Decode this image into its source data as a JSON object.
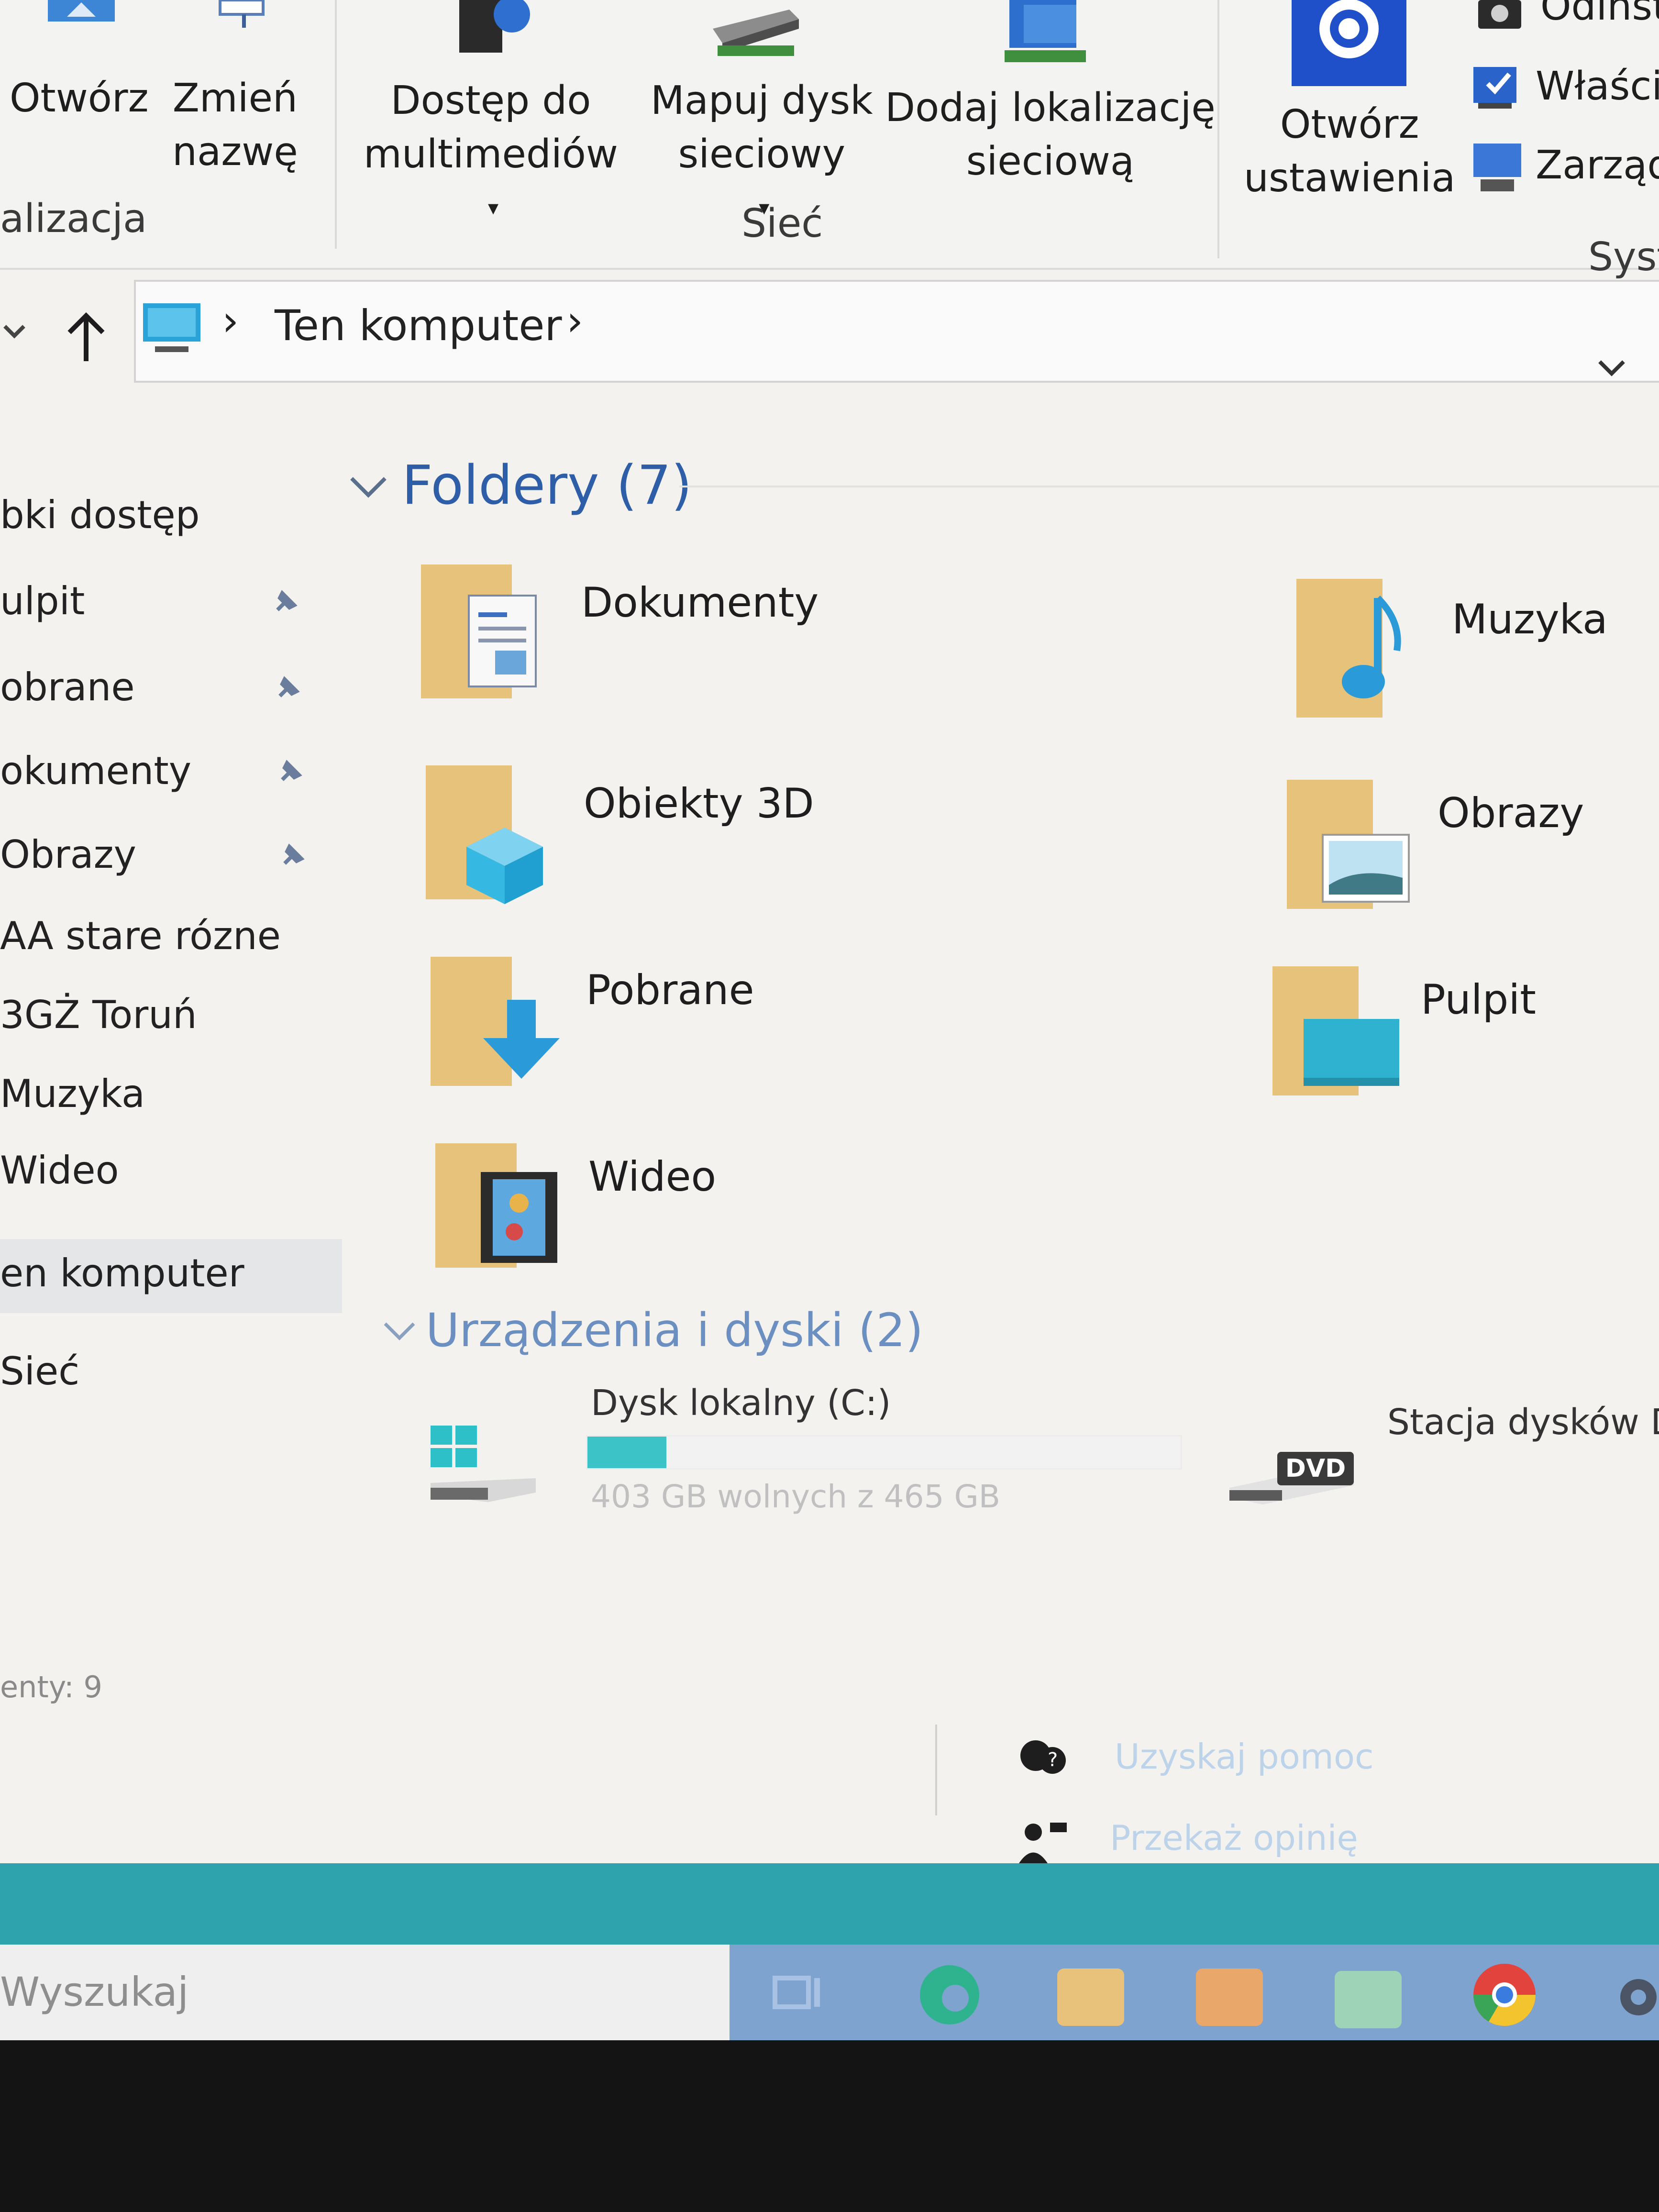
{
  "ribbon": {
    "open_label": "Otwórz",
    "rename_label_1": "Zmień",
    "rename_label_2": "nazwę",
    "location_group": "alizacja",
    "media_label_1": "Dostęp do",
    "media_label_2": "multimediów",
    "map_drive_label_1": "Mapuj dysk",
    "map_drive_label_2": "sieciowy",
    "add_location_label_1": "Dodaj lokalizację",
    "add_location_label_2": "sieciową",
    "network_group": "Sieć",
    "settings_label_1": "Otwórz",
    "settings_label_2": "ustawienia",
    "uninstall_label": "Odinst",
    "properties_label": "Właściw",
    "manage_label": "Zarządz",
    "system_group": "Syst"
  },
  "address": {
    "path_item": "Ten komputer"
  },
  "nav": {
    "quick_access": "bki dostęp",
    "items": [
      {
        "label": "ulpit"
      },
      {
        "label": "obrane"
      },
      {
        "label": "okumenty"
      },
      {
        "label": "Obrazy"
      },
      {
        "label": "AA stare rózne"
      },
      {
        "label": "3GŻ Toruń"
      },
      {
        "label": "Muzyka"
      },
      {
        "label": "Wideo"
      }
    ],
    "this_pc": "en komputer",
    "network": "Sieć"
  },
  "folders": {
    "header": "Foldery (7)",
    "items": [
      {
        "name": "Dokumenty"
      },
      {
        "name": "Muzyka"
      },
      {
        "name": "Obiekty 3D"
      },
      {
        "name": "Obrazy"
      },
      {
        "name": "Pobrane"
      },
      {
        "name": "Pulpit"
      },
      {
        "name": "Wideo"
      }
    ]
  },
  "devices": {
    "header": "Urządzenia i dyski (2)",
    "local_disk": {
      "name": "Dysk lokalny (C:)",
      "free_text": "403 GB wolnych z 465 GB",
      "used_fraction": 0.133
    },
    "dvd": {
      "name": "Stacja dysków DV",
      "badge": "DVD"
    }
  },
  "status": {
    "count_text": "enty: 9"
  },
  "help": {
    "get_help": "Uzyskaj pomoc",
    "feedback": "Przekaż opinię"
  },
  "taskbar": {
    "search_placeholder": "Wyszukaj"
  },
  "colors": {
    "accent": "#2ea3ad",
    "folder": "#f1d592",
    "header_blue": "#2e5ea8"
  }
}
